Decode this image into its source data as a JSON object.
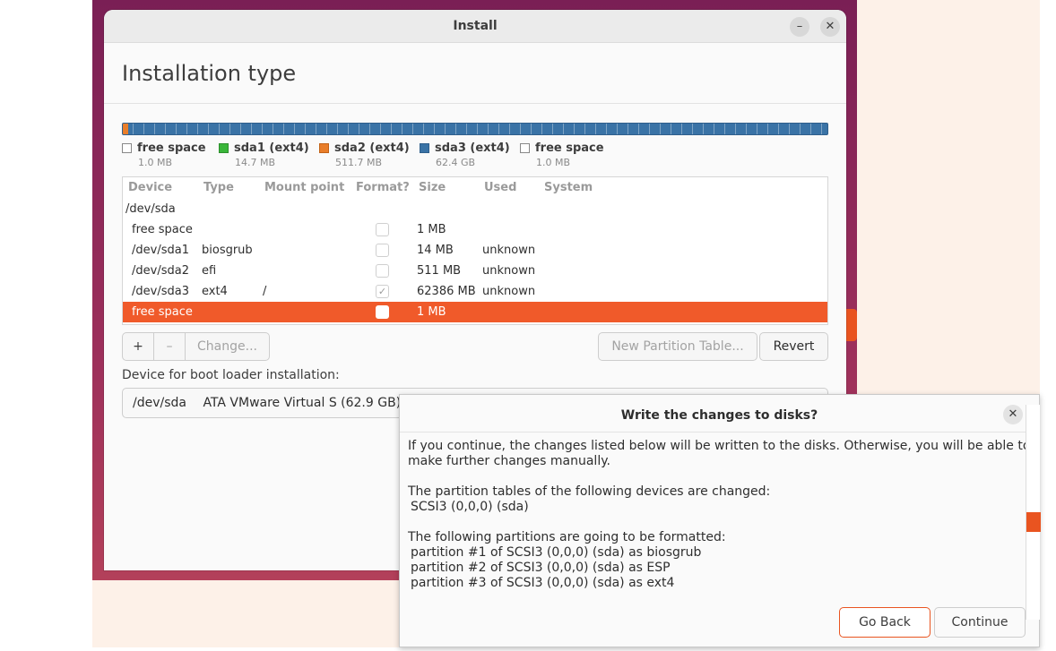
{
  "window": {
    "title": "Install",
    "minimize_icon": "–",
    "close_icon": "✕"
  },
  "page": {
    "heading": "Installation type"
  },
  "legend": [
    {
      "label": "free space",
      "size": "1.0 MB",
      "color": "#ffffff"
    },
    {
      "label": "sda1 (ext4)",
      "size": "14.7 MB",
      "color": "#3ab63a"
    },
    {
      "label": "sda2 (ext4)",
      "size": "511.7 MB",
      "color": "#e97e2a"
    },
    {
      "label": "sda3 (ext4)",
      "size": "62.4 GB",
      "color": "#3a73a6"
    },
    {
      "label": "free space",
      "size": "1.0 MB",
      "color": "#ffffff"
    }
  ],
  "table": {
    "headers": [
      "Device",
      "Type",
      "Mount point",
      "Format?",
      "Size",
      "Used",
      "System"
    ],
    "rows": [
      {
        "device": "/dev/sda",
        "type": "",
        "mount": "",
        "format": null,
        "size": "",
        "used": ""
      },
      {
        "device": "free space",
        "type": "",
        "mount": "",
        "format": false,
        "size": "1 MB",
        "used": ""
      },
      {
        "device": "/dev/sda1",
        "type": "biosgrub",
        "mount": "",
        "format": false,
        "size": "14 MB",
        "used": "unknown"
      },
      {
        "device": "/dev/sda2",
        "type": "efi",
        "mount": "",
        "format": false,
        "size": "511 MB",
        "used": "unknown"
      },
      {
        "device": "/dev/sda3",
        "type": "ext4",
        "mount": "/",
        "format": true,
        "size": "62386 MB",
        "used": "unknown"
      },
      {
        "device": "free space",
        "type": "",
        "mount": "",
        "format": false,
        "size": "1 MB",
        "used": "",
        "selected": true
      }
    ]
  },
  "buttons": {
    "add": "+",
    "remove": "–",
    "change": "Change...",
    "new_table": "New Partition Table...",
    "revert": "Revert"
  },
  "boot": {
    "label": "Device for boot loader installation:",
    "device": "/dev/sda",
    "description": "ATA VMware Virtual S (62.9 GB)"
  },
  "dialog": {
    "title": "Write the changes to disks?",
    "close_icon": "✕",
    "intro": "If you continue, the changes listed below will be written to the disks. Otherwise, you will be able to make further changes manually.",
    "tables_heading": "The partition tables of the following devices are changed:",
    "tables": [
      "SCSI3 (0,0,0) (sda)"
    ],
    "format_heading": "The following partitions are going to be formatted:",
    "partitions": [
      "partition #1 of SCSI3 (0,0,0) (sda) as biosgrub",
      "partition #2 of SCSI3 (0,0,0) (sda) as ESP",
      "partition #3 of SCSI3 (0,0,0) (sda) as ext4"
    ],
    "go_back": "Go Back",
    "continue": "Continue"
  },
  "colors": {
    "accent": "#e95420",
    "selection": "#f05a2a",
    "bar_blue": "#3a73a6"
  }
}
